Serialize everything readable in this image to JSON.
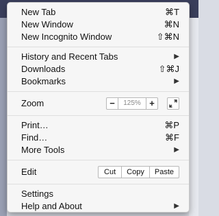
{
  "menu": {
    "group1": [
      {
        "label": "New Tab",
        "shortcut": "⌘T"
      },
      {
        "label": "New Window",
        "shortcut": "⌘N"
      },
      {
        "label": "New Incognito Window",
        "shortcut": "⇧⌘N"
      }
    ],
    "group2": [
      {
        "label": "History and Recent Tabs",
        "submenu": "▶"
      },
      {
        "label": "Downloads",
        "shortcut": "⇧⌘J"
      },
      {
        "label": "Bookmarks",
        "submenu": "▶"
      }
    ],
    "zoom": {
      "label": "Zoom",
      "minus": "−",
      "value": "125%",
      "plus": "+",
      "fullscreen_icon": "fullscreen-icon"
    },
    "group4": [
      {
        "label": "Print…",
        "shortcut": "⌘P"
      },
      {
        "label": "Find…",
        "shortcut": "⌘F"
      },
      {
        "label": "More Tools",
        "submenu": "▶"
      }
    ],
    "edit": {
      "label": "Edit",
      "cut": "Cut",
      "copy": "Copy",
      "paste": "Paste"
    },
    "group6": [
      {
        "label": "Settings"
      },
      {
        "label": "Help and About",
        "submenu": "▶"
      }
    ]
  }
}
